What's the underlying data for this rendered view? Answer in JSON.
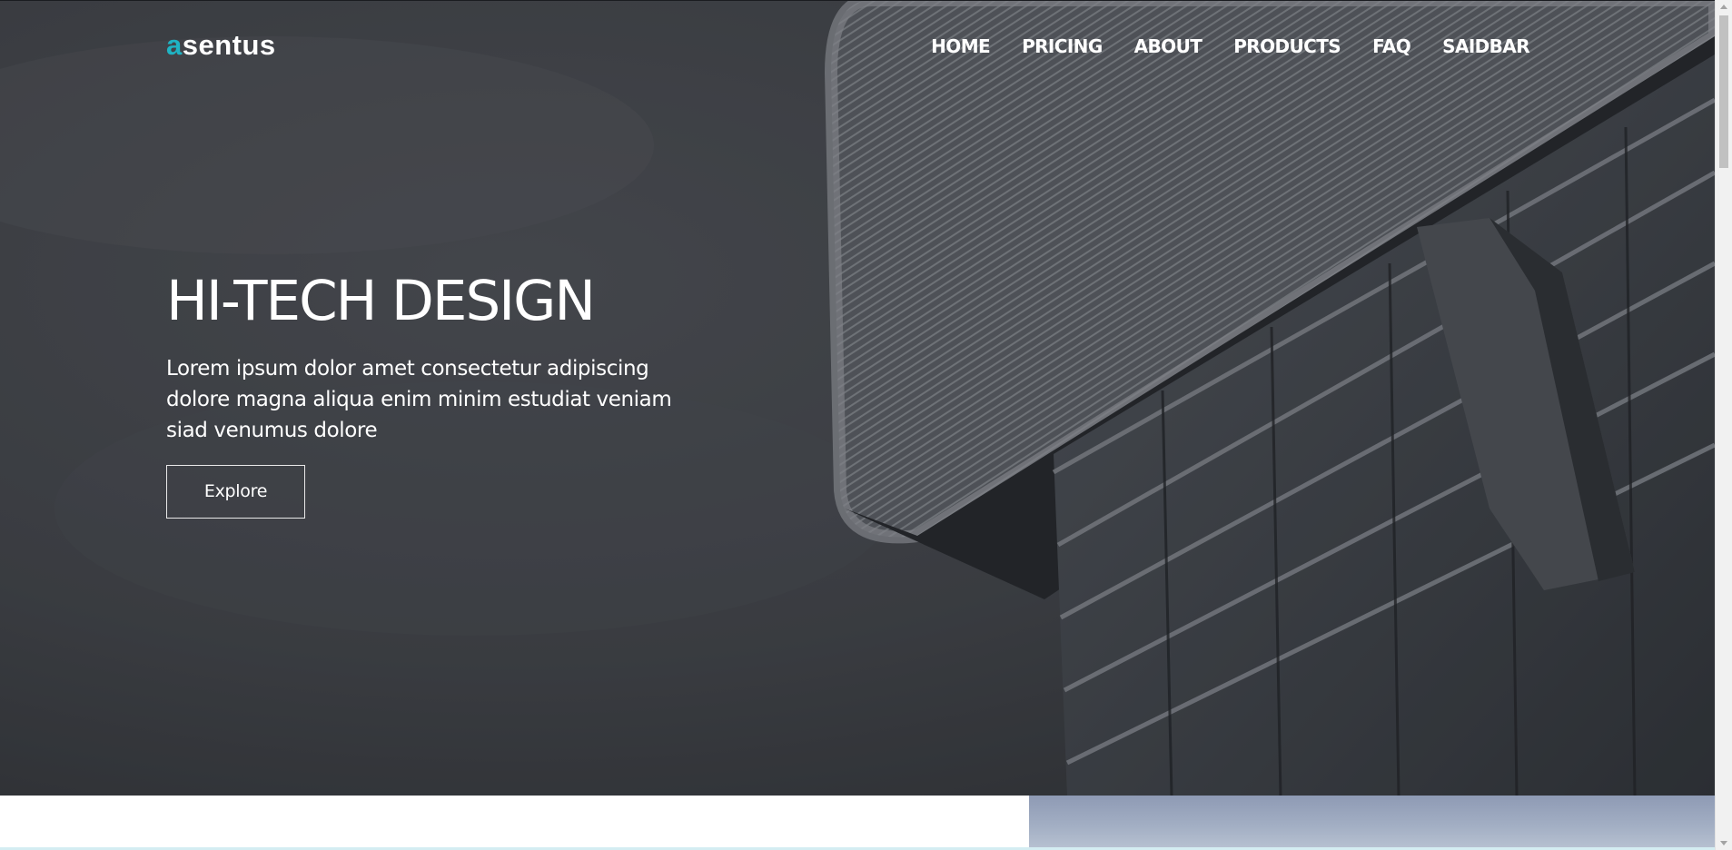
{
  "header": {
    "logo_accent": "a",
    "logo_rest": "sentus",
    "nav": [
      "HOME",
      "PRICING",
      "ABOUT",
      "PRODUCTS",
      "FAQ",
      "SAIDBAR"
    ]
  },
  "hero": {
    "title": "HI-TECH DESIGN",
    "text": "Lorem ipsum dolor amet consectetur adipiscing dolore magna aliqua enim minim estudiat veniam siad venumus dolore",
    "button_label": "Explore"
  },
  "colors": {
    "accent": "#1fb3c3",
    "hero_overlay": "#3b3d42"
  }
}
